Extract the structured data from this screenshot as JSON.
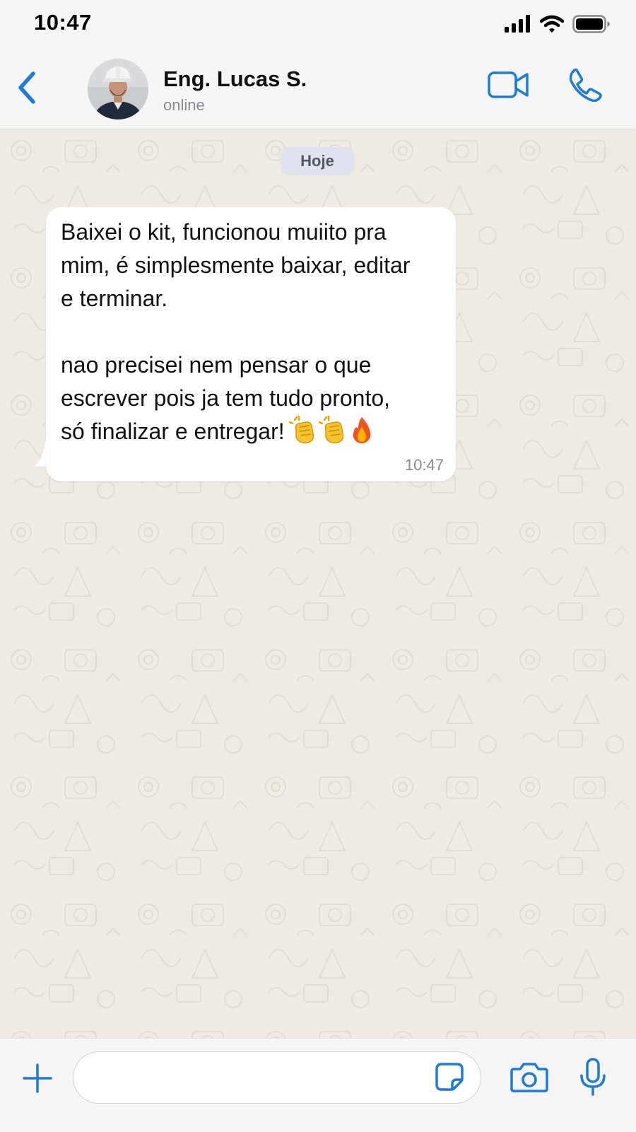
{
  "status_bar": {
    "time": "10:47",
    "icons": [
      "signal-icon",
      "wifi-icon",
      "battery-icon"
    ]
  },
  "header": {
    "contact_name": "Eng. Lucas S.",
    "contact_status": "online",
    "icons": {
      "back": "chevron-left-icon",
      "video": "video-camera-icon",
      "call": "phone-icon"
    }
  },
  "chat": {
    "date_label": "Hoje",
    "message": {
      "paragraph_1": [
        "Baixei o kit, funcionou muiito pra",
        "mim, é simplesmente baixar, editar",
        "e terminar."
      ],
      "paragraph_2": [
        "nao precisei nem pensar o que",
        "escrever pois ja tem tudo pronto,",
        "só finalizar e entregar!"
      ],
      "emojis": [
        "clapping-hands-icon",
        "clapping-hands-icon",
        "fire-icon"
      ],
      "time": "10:47"
    }
  },
  "input_bar": {
    "placeholder": "",
    "icons": {
      "attach": "plus-icon",
      "sticker": "sticker-icon",
      "camera": "camera-icon",
      "mic": "microphone-icon"
    }
  },
  "colors": {
    "accent": "#1f7bdb",
    "chat_background": "#efeae2",
    "bubble": "#ffffff",
    "date_chip": "#dfe4ef"
  }
}
